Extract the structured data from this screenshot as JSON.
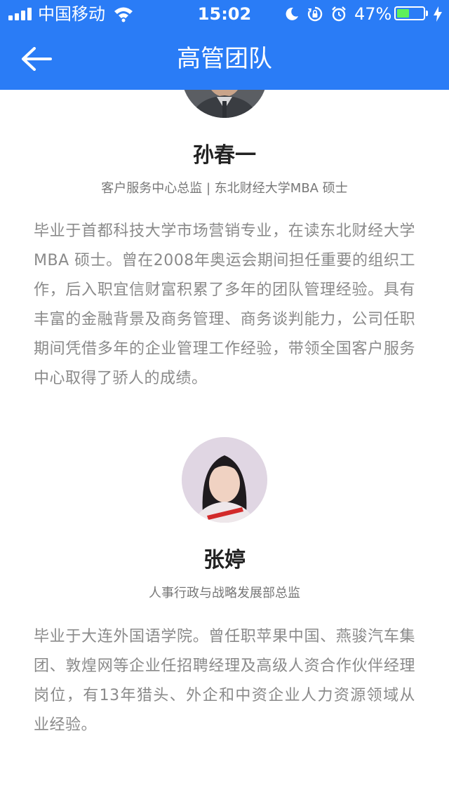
{
  "status_bar": {
    "carrier": "中国移动",
    "time": "15:02",
    "battery_percent": "47%",
    "battery_level": 0.47,
    "icons": [
      "signal-icon",
      "wifi-icon",
      "moon-icon",
      "rotation-lock-icon",
      "alarm-icon",
      "battery-icon",
      "charging-icon"
    ]
  },
  "nav": {
    "back_icon": "arrow-left-icon",
    "title": "高管团队"
  },
  "members": [
    {
      "name": "孙春一",
      "title": "客户服务中心总监 | 东北财经大学MBA 硕士",
      "bio": "毕业于首都科技大学市场营销专业，在读东北财经大学MBA 硕士。曾在2008年奥运会期间担任重要的组织工作，后入职宜信财富积累了多年的团队管理经验。具有丰富的金融背景及商务管理、商务谈判能力，公司任职期间凭借多年的企业管理工作经验，带领全国客户服务中心取得了骄人的成绩。"
    },
    {
      "name": "张婷",
      "title": "人事行政与战略发展部总监",
      "bio": "毕业于大连外国语学院。曾任职苹果中国、燕骏汽车集团、敦煌网等企业任招聘经理及高级人资合作伙伴经理岗位，有13年猎头、外企和中资企业人力资源领域从业经验。"
    }
  ],
  "colors": {
    "header_blue": "#2a7cf6",
    "name_text": "#222222",
    "title_text": "#777777",
    "bio_text": "#8a8a8a",
    "battery_green": "#5ef05a"
  }
}
